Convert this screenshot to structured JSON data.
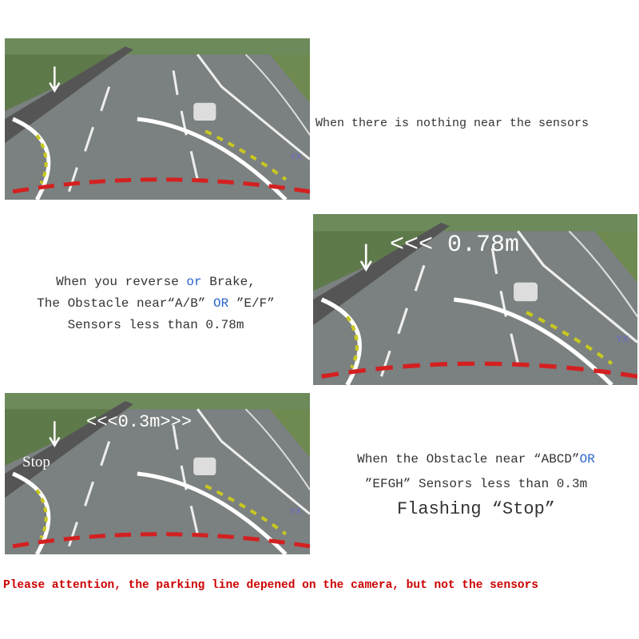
{
  "panels": [
    {
      "caption": "When there is nothing near the sensors",
      "overlay": "",
      "watermark": "YX"
    },
    {
      "line1": {
        "a": "When you reverse ",
        "b": "or",
        "c": " Brake,"
      },
      "line2": {
        "a": "The Obstacle near“A/B” ",
        "b": "OR",
        "c": " ”E/F”"
      },
      "line3": "Sensors less than 0.78m",
      "overlay": "<<< 0.78m",
      "watermark": "YX"
    },
    {
      "line1": {
        "a": "When the Obstacle near “ABCD”",
        "b": "OR"
      },
      "line2": "”EFGH” Sensors less than 0.3m",
      "line3": "Flashing “Stop”",
      "overlay": "<<<0.3m>>>",
      "stop": "Stop",
      "watermark": "YX"
    }
  ],
  "footer": "Please attention, the parking line depened on the camera, but not the sensors",
  "colors": {
    "accent_blue": "#2a62c9",
    "footer_red": "#cc0000",
    "guide_red": "#d42020"
  }
}
